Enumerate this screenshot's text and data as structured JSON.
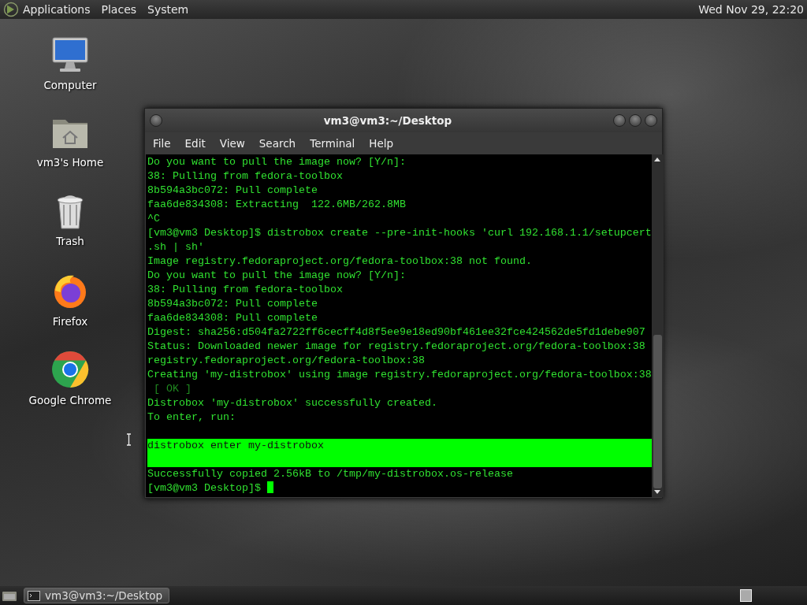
{
  "top_panel": {
    "menus": [
      "Applications",
      "Places",
      "System"
    ],
    "clock": "Wed Nov 29, 22:20"
  },
  "desktop_icons": [
    {
      "kind": "computer",
      "label": "Computer"
    },
    {
      "kind": "home",
      "label": "vm3's Home"
    },
    {
      "kind": "trash",
      "label": "Trash"
    },
    {
      "kind": "firefox",
      "label": "Firefox"
    },
    {
      "kind": "chrome",
      "label": "Google Chrome"
    }
  ],
  "terminal": {
    "title": "vm3@vm3:~/Desktop",
    "menu": [
      "File",
      "Edit",
      "View",
      "Search",
      "Terminal",
      "Help"
    ],
    "lines": [
      {
        "kind": "output",
        "text": "Do you want to pull the image now? [Y/n]:"
      },
      {
        "kind": "output",
        "text": "38: Pulling from fedora-toolbox"
      },
      {
        "kind": "output",
        "text": "8b594a3bc072: Pull complete"
      },
      {
        "kind": "output",
        "text": "faa6de834308: Extracting  122.6MB/262.8MB"
      },
      {
        "kind": "output",
        "text": "^C"
      },
      {
        "kind": "output",
        "text": "[vm3@vm3 Desktop]$ distrobox create --pre-init-hooks 'curl 192.168.1.1/setupcert"
      },
      {
        "kind": "output",
        "text": ".sh | sh'"
      },
      {
        "kind": "output",
        "text": "Image registry.fedoraproject.org/fedora-toolbox:38 not found."
      },
      {
        "kind": "output",
        "text": "Do you want to pull the image now? [Y/n]:"
      },
      {
        "kind": "output",
        "text": "38: Pulling from fedora-toolbox"
      },
      {
        "kind": "output",
        "text": "8b594a3bc072: Pull complete"
      },
      {
        "kind": "output",
        "text": "faa6de834308: Pull complete"
      },
      {
        "kind": "output",
        "text": "Digest: sha256:d504fa2722ff6cecff4d8f5ee9e18ed90bf461ee32fce424562de5fd1debe907"
      },
      {
        "kind": "output",
        "text": "Status: Downloaded newer image for registry.fedoraproject.org/fedora-toolbox:38"
      },
      {
        "kind": "output",
        "text": "registry.fedoraproject.org/fedora-toolbox:38"
      },
      {
        "kind": "output",
        "text": "Creating 'my-distrobox' using image registry.fedoraproject.org/fedora-toolbox:38"
      },
      {
        "kind": "dim",
        "text": " [ OK ]"
      },
      {
        "kind": "output",
        "text": "Distrobox 'my-distrobox' successfully created."
      },
      {
        "kind": "output",
        "text": "To enter, run:"
      },
      {
        "kind": "blank"
      },
      {
        "kind": "highlight",
        "text": "distrobox enter my-distrobox"
      },
      {
        "kind": "output",
        "text": "Successfully copied 2.56kB to /tmp/my-distrobox.os-release"
      },
      {
        "kind": "prompt",
        "text": "[vm3@vm3 Desktop]$"
      }
    ]
  },
  "taskbar": {
    "tasks": [
      {
        "label": "vm3@vm3:~/Desktop",
        "selected": true
      }
    ]
  }
}
